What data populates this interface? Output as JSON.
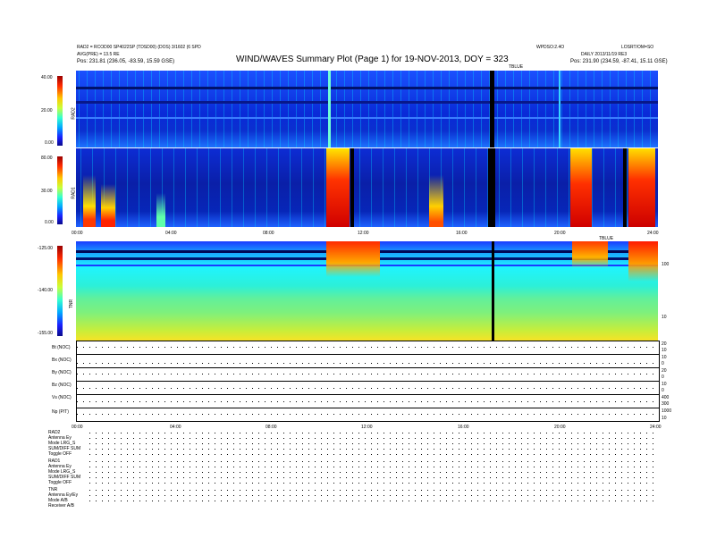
{
  "header": {
    "title": "WIND/WAVES Summary Plot (Page 1) for 19-NOV-2013, DOY = 323",
    "left_line1": "RAD2 = RCOD00 SP4022SP (TDSD00) (DOS) 3/1602 (6 SPD",
    "left_line2": "AVG(PRE) = 13.5 RE",
    "left_line3": "Pos:    231.81 (236.05, -83.59, 15.59 GSE)",
    "right_line1_a": "WPDSO:2.4O",
    "right_line1_b": "LOSRT/OM=SO",
    "right_line2": "DAILY 2013/11/19 RE3",
    "right_line3": "Pos:    231.90 (234.59, -87.41, 15.11 GSE)",
    "mid_label": "TBLUE"
  },
  "chart_data": [
    {
      "type": "heatmap",
      "name": "RAD2",
      "ylabel": "RAD2",
      "y_ticks": [
        "40.00",
        "20.00",
        "0.00"
      ],
      "colorbar": "blue-red"
    },
    {
      "type": "heatmap",
      "name": "RAD1",
      "ylabel": "RAD1",
      "y_ticks": [
        "80.00",
        "30.00",
        "0.00"
      ],
      "x_ticks": [
        "00:00",
        "04:00",
        "08:00",
        "12:00",
        "16:00",
        "20:00",
        "24:00"
      ],
      "right_label": "TBLUE"
    },
    {
      "type": "heatmap",
      "name": "TNR",
      "ylabel": "TNR",
      "y_ticks": [
        "-125.00",
        "-140.00",
        "-155.00"
      ],
      "right_ticks": [
        "100",
        "10"
      ],
      "right_label": "DAY0E"
    },
    {
      "type": "line",
      "series": [
        {
          "label": "Bt (NOC)",
          "right_ticks": [
            "20",
            "10"
          ]
        },
        {
          "label": "Bx (NOC)",
          "right_ticks": [
            "10",
            "0"
          ]
        },
        {
          "label": "By (NOC)",
          "right_ticks": [
            "20",
            "0"
          ]
        },
        {
          "label": "Bz (NOC)",
          "right_ticks": [
            "10",
            "0"
          ]
        },
        {
          "label": "Vs (NOC)",
          "right_ticks": [
            "400",
            "300"
          ]
        },
        {
          "label": "Np (P/T)",
          "right_ticks": [
            "1000",
            "10"
          ]
        }
      ],
      "x_ticks": [
        "00:00",
        "04:00",
        "08:00",
        "12:00",
        "16:00",
        "20:00",
        "24:00"
      ]
    }
  ],
  "footer": {
    "rad2_block": [
      {
        "label": "RAD2",
        "value": ""
      },
      {
        "label": "Antenna",
        "value": "Ey"
      },
      {
        "label": "Mode",
        "value": "LRG_S"
      },
      {
        "label": "SUM/DIFF",
        "value": "SUM"
      },
      {
        "label": "Toggle",
        "value": "OFF"
      }
    ],
    "rad1_block": [
      {
        "label": "RAD1",
        "value": ""
      },
      {
        "label": "Antenna",
        "value": "Ey"
      },
      {
        "label": "Mode",
        "value": "LRG_S"
      },
      {
        "label": "SUM/DIFF",
        "value": "SUM"
      },
      {
        "label": "Toggle",
        "value": "OFF"
      }
    ],
    "tnr_block": [
      {
        "label": "TNR",
        "value": ""
      },
      {
        "label": "Antenna",
        "value": "Ey/Ey"
      },
      {
        "label": "Mode",
        "value": "A/B"
      },
      {
        "label": "Receiver",
        "value": "A/B"
      }
    ]
  }
}
